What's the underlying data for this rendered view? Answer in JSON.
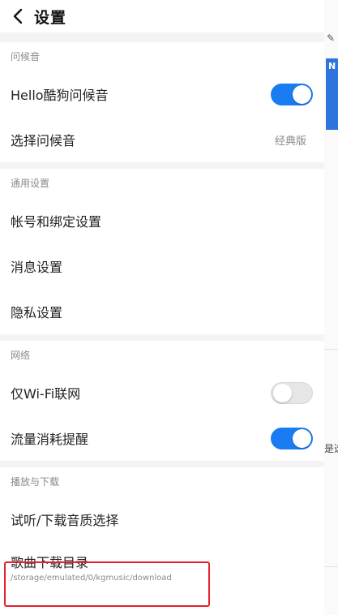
{
  "header": {
    "title": "设置",
    "back_icon": "chevron-left-icon"
  },
  "sections": {
    "greeting": {
      "label": "问候音",
      "hello_toggle_label": "Hello酷狗问候音",
      "hello_toggle_state": true,
      "select_label": "选择问候音",
      "select_value": "经典版"
    },
    "general": {
      "label": "通用设置",
      "account_label": "帐号和绑定设置",
      "message_label": "消息设置",
      "privacy_label": "隐私设置"
    },
    "network": {
      "label": "网络",
      "wifi_only_label": "仅Wi-Fi联网",
      "wifi_only_state": false,
      "traffic_label": "流量消耗提醒",
      "traffic_state": true
    },
    "playback": {
      "label": "播放与下载",
      "quality_label": "试听/下载音质选择",
      "dir_label": "歌曲下载目录",
      "dir_path": "/storage/emulated/0/kgmusic/download"
    }
  },
  "background": {
    "badge_letter": "N",
    "edge_text": "是选"
  },
  "colors": {
    "accent": "#1a7cf2",
    "highlight_border": "#e8202a"
  }
}
